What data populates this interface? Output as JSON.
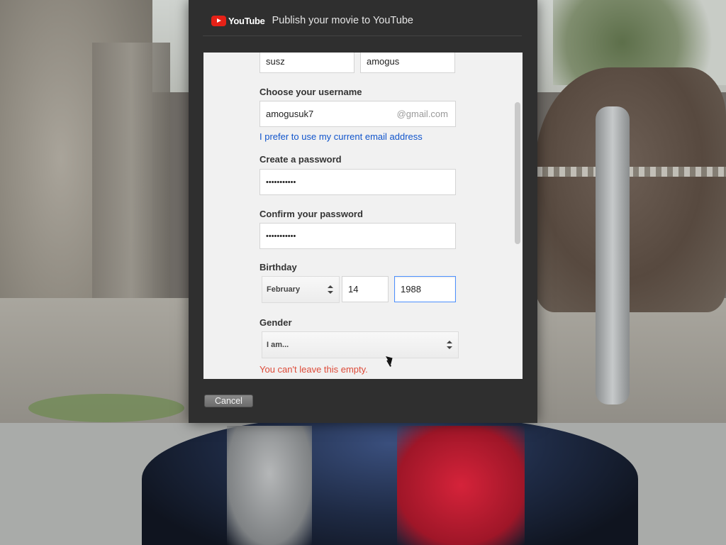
{
  "dialog": {
    "brand": "YouTube",
    "title": "Publish your movie to YouTube",
    "cancel_label": "Cancel"
  },
  "form": {
    "first_name": "susz",
    "last_name": "amogus",
    "username_label": "Choose your username",
    "username_value": "amogusuk7",
    "username_suffix": "@gmail.com",
    "use_email_link": "I prefer to use my current email address",
    "password_label": "Create a password",
    "password_value": "•••••••••••",
    "confirm_label": "Confirm your password",
    "confirm_value": "•••••••••••",
    "birthday_label": "Birthday",
    "birth_month": "February",
    "birth_day": "14",
    "birth_year": "1988",
    "gender_label": "Gender",
    "gender_value": "I am...",
    "gender_error": "You can't leave this empty."
  },
  "colors": {
    "accent_focus": "#4d90fe",
    "link": "#1155cc",
    "error": "#dd4b39",
    "youtube_red": "#e62117"
  }
}
